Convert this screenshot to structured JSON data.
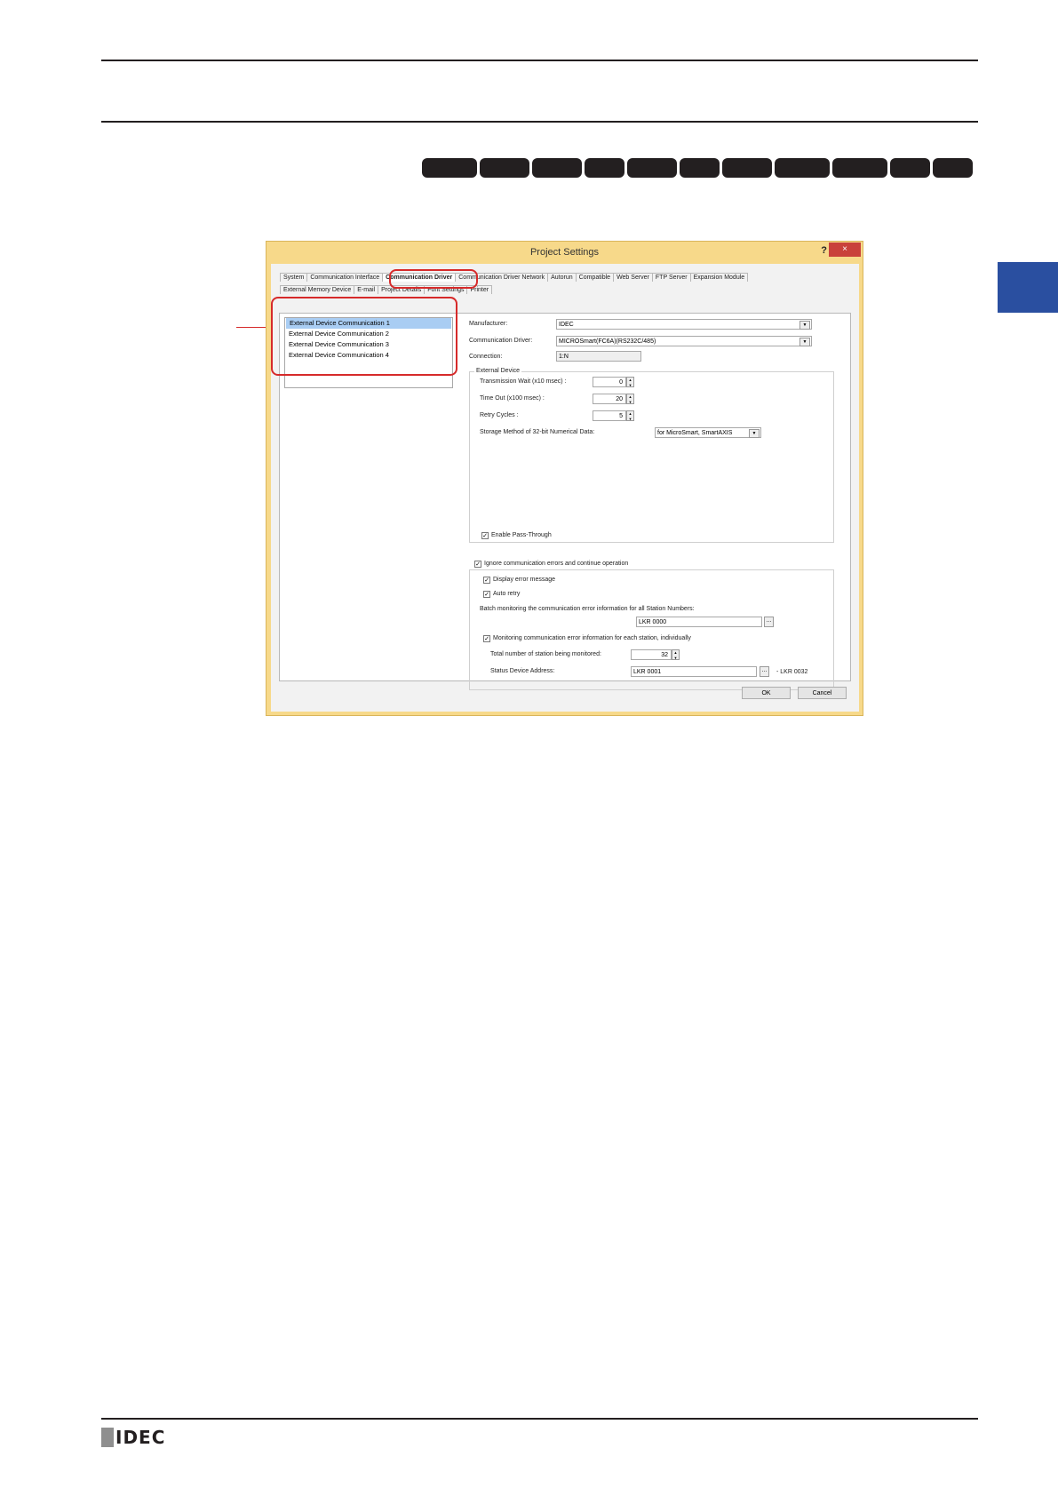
{
  "dialog": {
    "title": "Project Settings",
    "help": "?",
    "close": "×",
    "tabs_row1": [
      "System",
      "Communication Interface",
      "Communication Driver",
      "Communication Driver Network",
      "Autorun",
      "Compatible",
      "Web Server",
      "FTP Server",
      "Expansion Module"
    ],
    "tabs_row2": [
      "External Memory Device",
      "E-mail",
      "Project Details",
      "Font Settings",
      "Printer"
    ],
    "active_tab": "Communication Driver",
    "device_list": [
      "External Device Communication 1",
      "External Device Communication 2",
      "External Device Communication 3",
      "External Device Communication 4"
    ],
    "selected_device": "External Device Communication 1",
    "manufacturer_label": "Manufacturer:",
    "manufacturer_value": "IDEC",
    "driver_label": "Communication Driver:",
    "driver_value": "MICROSmart(FC6A)(RS232C/485)",
    "connection_label": "Connection:",
    "connection_value": "1:N",
    "external_device_label": "External Device",
    "tx_wait_label": "Transmission Wait (x10 msec) :",
    "tx_wait_value": "0",
    "timeout_label": "Time Out (x100 msec) :",
    "timeout_value": "20",
    "retry_label": "Retry Cycles :",
    "retry_value": "5",
    "storage_label": "Storage Method of 32-bit Numerical Data:",
    "storage_value": "for MicroSmart, SmartAXIS",
    "pass_through_label": "Enable Pass-Through",
    "ignore_errors_label": "Ignore communication errors and continue operation",
    "display_error_label": "Display error message",
    "auto_retry_label": "Auto retry",
    "batch_label": "Batch monitoring the communication error information for all Station Numbers:",
    "batch_value": "LKR 0000",
    "monitor_each_label": "Monitoring communication error information for each station, individually",
    "total_label": "Total number of station being monitored:",
    "total_value": "32",
    "status_label": "Status Device Address:",
    "status_value": "LKR 0001",
    "status_range": "- LKR 0032",
    "ellipsis": "...",
    "ok": "OK",
    "cancel": "Cancel"
  },
  "footer": {
    "logo_text": "IDEC"
  },
  "colors": {
    "accent_blue": "#2a4fa0",
    "callout_red": "#d62a2a",
    "dialog_frame": "#f7d98a"
  }
}
